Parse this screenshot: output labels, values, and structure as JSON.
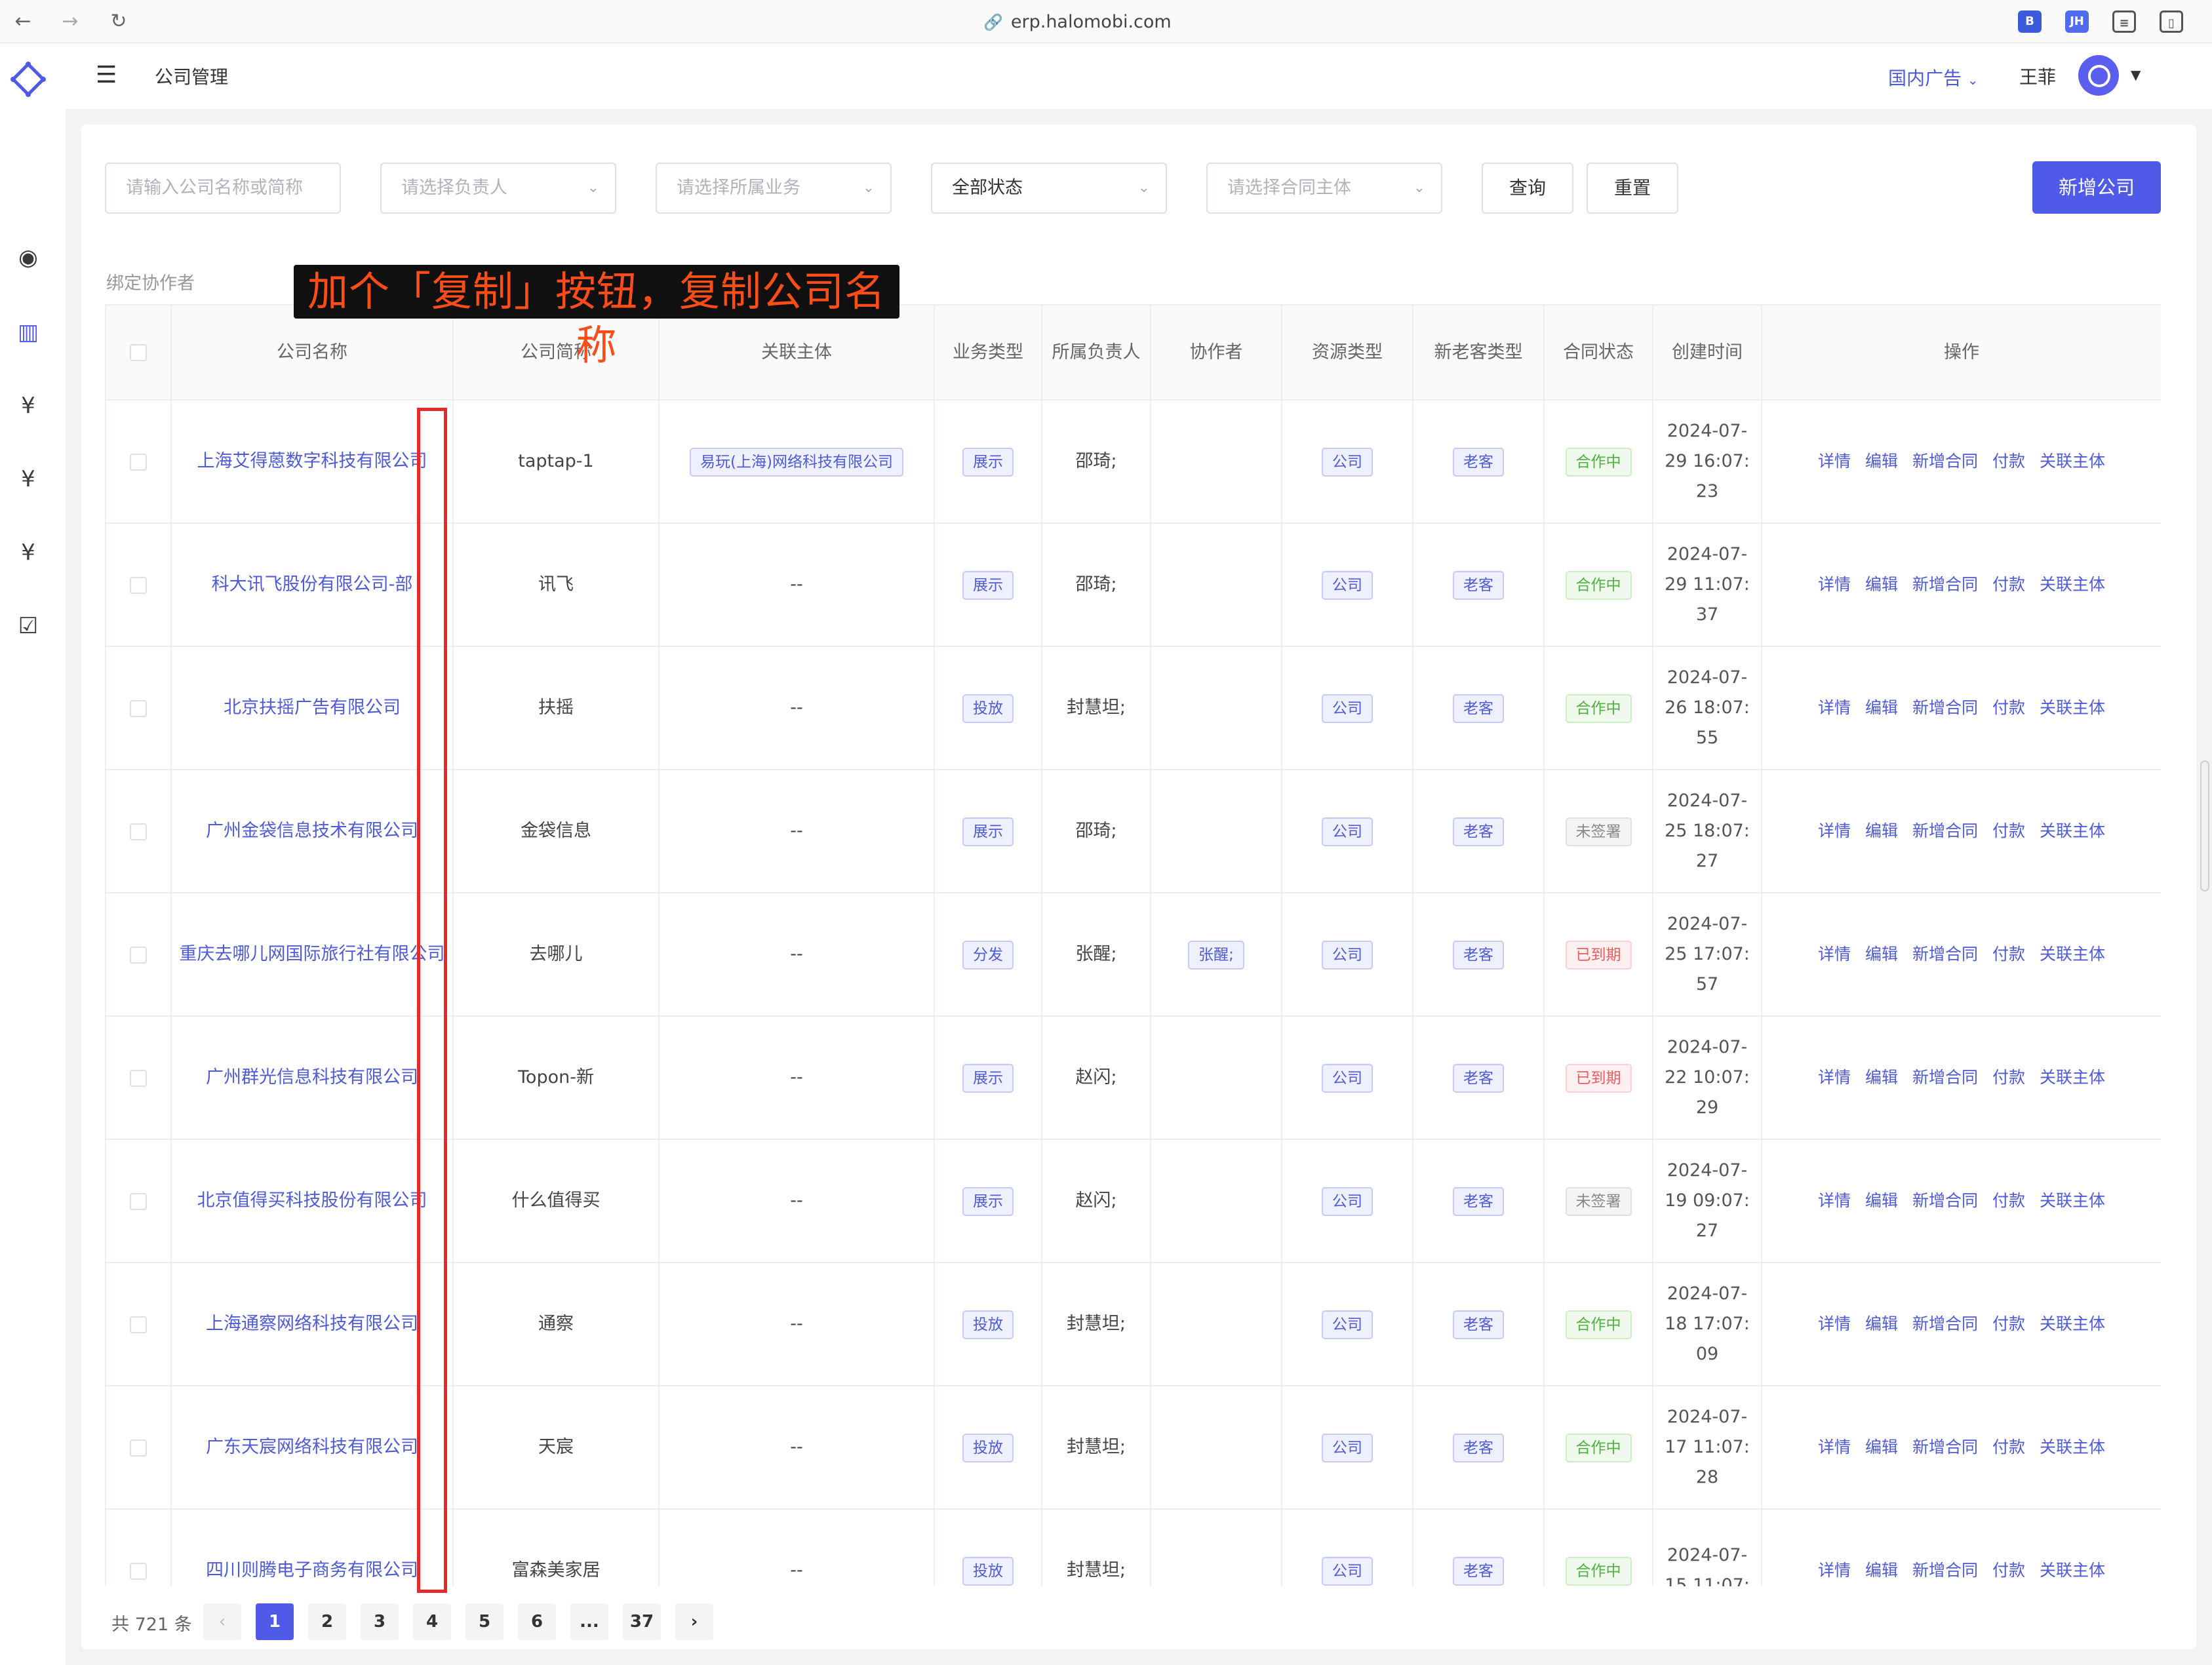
{
  "browser": {
    "url": "erp.halomobi.com",
    "ext_labels": [
      "JH"
    ]
  },
  "header": {
    "page_title": "公司管理",
    "domain_select": "国内广告",
    "username": "王菲"
  },
  "filters": {
    "company_placeholder": "请输入公司名称或简称",
    "owner_placeholder": "请选择负责人",
    "business_placeholder": "请选择所属业务",
    "status_value": "全部状态",
    "contract_placeholder": "请选择合同主体",
    "query_label": "查询",
    "reset_label": "重置",
    "add_label": "新增公司"
  },
  "bind_collaborator": "绑定协作者",
  "annotation": "加个「复制」按钮，复制公司名称",
  "table": {
    "headers": [
      "公司名称",
      "公司简称",
      "关联主体",
      "业务类型",
      "所属负责人",
      "协作者",
      "资源类型",
      "新老客类型",
      "合同状态",
      "创建时间",
      "操作"
    ],
    "ops": [
      "详情",
      "编辑",
      "新增合同",
      "付款",
      "关联主体"
    ],
    "rows": [
      {
        "name": "上海艾得蒽数字科技有限公司",
        "short": "taptap-1",
        "entity": "易玩(上海)网络科技有限公司",
        "biz": "展示",
        "owner": "邵琦;",
        "collab": "",
        "res": "公司",
        "cust": "老客",
        "status": "合作中",
        "time1": "2024-07-",
        "time2": "29 16:07:",
        "time3": "23"
      },
      {
        "name": "科大讯飞股份有限公司-部",
        "short": "讯飞",
        "entity": "--",
        "biz": "展示",
        "owner": "邵琦;",
        "collab": "",
        "res": "公司",
        "cust": "老客",
        "status": "合作中",
        "time1": "2024-07-",
        "time2": "29 11:07:",
        "time3": "37"
      },
      {
        "name": "北京扶摇广告有限公司",
        "short": "扶摇",
        "entity": "--",
        "biz": "投放",
        "owner": "封慧坦;",
        "collab": "",
        "res": "公司",
        "cust": "老客",
        "status": "合作中",
        "time1": "2024-07-",
        "time2": "26 18:07:",
        "time3": "55"
      },
      {
        "name": "广州金袋信息技术有限公司",
        "short": "金袋信息",
        "entity": "--",
        "biz": "展示",
        "owner": "邵琦;",
        "collab": "",
        "res": "公司",
        "cust": "老客",
        "status": "未签署",
        "time1": "2024-07-",
        "time2": "25 18:07:",
        "time3": "27"
      },
      {
        "name": "重庆去哪儿网国际旅行社有限公司",
        "short": "去哪儿",
        "entity": "--",
        "biz": "分发",
        "owner": "张醒;",
        "collab": "张醒;",
        "res": "公司",
        "cust": "老客",
        "status": "已到期",
        "time1": "2024-07-",
        "time2": "25 17:07:",
        "time3": "57"
      },
      {
        "name": "广州群光信息科技有限公司",
        "short": "Topon-新",
        "entity": "--",
        "biz": "展示",
        "owner": "赵闪;",
        "collab": "",
        "res": "公司",
        "cust": "老客",
        "status": "已到期",
        "time1": "2024-07-",
        "time2": "22 10:07:",
        "time3": "29"
      },
      {
        "name": "北京值得买科技股份有限公司",
        "short": "什么值得买",
        "entity": "--",
        "biz": "展示",
        "owner": "赵闪;",
        "collab": "",
        "res": "公司",
        "cust": "老客",
        "status": "未签署",
        "time1": "2024-07-",
        "time2": "19 09:07:",
        "time3": "27"
      },
      {
        "name": "上海通察网络科技有限公司",
        "short": "通察",
        "entity": "--",
        "biz": "投放",
        "owner": "封慧坦;",
        "collab": "",
        "res": "公司",
        "cust": "老客",
        "status": "合作中",
        "time1": "2024-07-",
        "time2": "18 17:07:",
        "time3": "09"
      },
      {
        "name": "广东天宸网络科技有限公司",
        "short": "天宸",
        "entity": "--",
        "biz": "投放",
        "owner": "封慧坦;",
        "collab": "",
        "res": "公司",
        "cust": "老客",
        "status": "合作中",
        "time1": "2024-07-",
        "time2": "17 11:07:",
        "time3": "28"
      },
      {
        "name": "四川则腾电子商务有限公司",
        "short": "富森美家居",
        "entity": "--",
        "biz": "投放",
        "owner": "封慧坦;",
        "collab": "",
        "res": "公司",
        "cust": "老客",
        "status": "合作中",
        "time1": "2024-07-",
        "time2": "15 11:07:",
        "time3": ""
      }
    ]
  },
  "pagination": {
    "total": "共 721 条",
    "pages": [
      "1",
      "2",
      "3",
      "4",
      "5",
      "6",
      "...",
      "37"
    ],
    "current": "1"
  },
  "colors": {
    "primary": "#4f5be8",
    "link": "#4f5bd5",
    "annotation_box": "#e32b2b",
    "annotation_text": "#ff4d1a"
  },
  "icons": {
    "back": "arrow-left-icon",
    "forward": "arrow-right-icon",
    "reload": "reload-icon",
    "sidebar": [
      "eye-icon",
      "building-icon",
      "yuan-circle-icon",
      "yuan-search-icon",
      "yuan-doc-icon",
      "clipboard-check-icon"
    ]
  }
}
